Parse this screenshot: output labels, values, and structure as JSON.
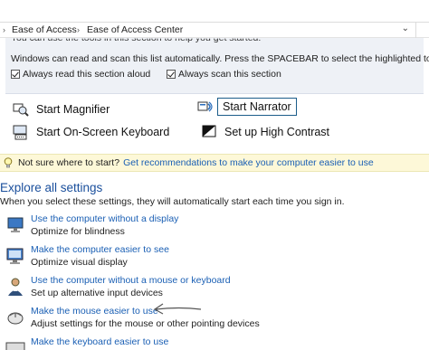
{
  "addressbar": {
    "crumb1": "Ease of Access",
    "crumb2": "Ease of Access Center",
    "sep": "›",
    "dropdown": "⌄"
  },
  "panel": {
    "cut_text": "You can use the tools in this section to help you get started.",
    "scan_text": "Windows can read and scan this list automatically.  Press the SPACEBAR to select the highlighted tool.",
    "checkbox_read": "Always read this section aloud",
    "checkbox_scan": "Always scan this section"
  },
  "tools": {
    "magnifier": "Start Magnifier",
    "narrator": "Start Narrator",
    "keyboard": "Start On-Screen Keyboard",
    "contrast": "Set up High Contrast"
  },
  "hint": {
    "question": "Not sure where to start?",
    "link": "Get recommendations to make your computer easier to use"
  },
  "explore": {
    "title": "Explore all settings",
    "subtitle": "When you select these settings, they will automatically start each time you sign in."
  },
  "settings": [
    {
      "link": "Use the computer without a display",
      "desc": "Optimize for blindness",
      "icon": "display-icon"
    },
    {
      "link": "Make the computer easier to see",
      "desc": "Optimize visual display",
      "icon": "monitor-icon"
    },
    {
      "link": "Use the computer without a mouse or keyboard",
      "desc": "Set up alternative input devices",
      "icon": "person-icon"
    },
    {
      "link": "Make the mouse easier to use",
      "desc": "Adjust settings for the mouse or other pointing devices",
      "icon": "mouse-icon"
    },
    {
      "link": "Make the keyboard easier to use",
      "desc": "",
      "icon": "keyboard-icon"
    }
  ],
  "colors": {
    "link": "#1a5fb4",
    "heading": "#1a4f9c",
    "hint_bg": "#fdf8d8",
    "panel_bg": "#eef1f6"
  }
}
